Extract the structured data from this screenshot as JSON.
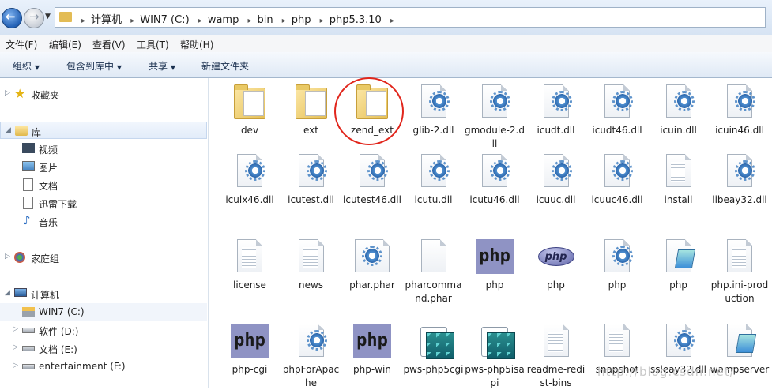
{
  "address_bar": {
    "crumbs": [
      "计算机",
      "WIN7 (C:)",
      "wamp",
      "bin",
      "php",
      "php5.3.10"
    ]
  },
  "menu": [
    "文件(F)",
    "编辑(E)",
    "查看(V)",
    "工具(T)",
    "帮助(H)"
  ],
  "toolbar": {
    "organize": "组织",
    "include_in_library": "包含到库中",
    "share": "共享",
    "new_folder": "新建文件夹"
  },
  "nav": {
    "favorites": "收藏夹",
    "libraries": "库",
    "lib_items": [
      "视频",
      "图片",
      "文档",
      "迅雷下载",
      "音乐"
    ],
    "homegroup": "家庭组",
    "computer": "计算机",
    "drives": [
      "WIN7 (C:)",
      "软件 (D:)",
      "文档 (E:)",
      "entertainment (F:)"
    ]
  },
  "files": [
    {
      "name": "dev",
      "icon": "folder-icon"
    },
    {
      "name": "ext",
      "icon": "folder-icon"
    },
    {
      "name": "zend_ext",
      "icon": "folder-icon"
    },
    {
      "name": "glib-2.dll",
      "icon": "dll-icon"
    },
    {
      "name": "gmodule-2.dll",
      "icon": "dll-icon"
    },
    {
      "name": "icudt.dll",
      "icon": "dll-icon"
    },
    {
      "name": "icudt46.dll",
      "icon": "dll-icon"
    },
    {
      "name": "icuin.dll",
      "icon": "dll-icon"
    },
    {
      "name": "icuin46.dll",
      "icon": "dll-icon"
    },
    {
      "name": "iculx46.dll",
      "icon": "dll-icon"
    },
    {
      "name": "icutest.dll",
      "icon": "dll-icon"
    },
    {
      "name": "icutest46.dll",
      "icon": "dll-icon"
    },
    {
      "name": "icutu.dll",
      "icon": "dll-icon"
    },
    {
      "name": "icutu46.dll",
      "icon": "dll-icon"
    },
    {
      "name": "icuuc.dll",
      "icon": "dll-icon"
    },
    {
      "name": "icuuc46.dll",
      "icon": "dll-icon"
    },
    {
      "name": "install",
      "icon": "text-file-icon"
    },
    {
      "name": "libeay32.dll",
      "icon": "dll-icon"
    },
    {
      "name": "license",
      "icon": "text-file-icon"
    },
    {
      "name": "news",
      "icon": "text-file-icon"
    },
    {
      "name": "phar.phar",
      "icon": "gear-file-icon"
    },
    {
      "name": "pharcommand.phar",
      "icon": "blank-file-icon"
    },
    {
      "name": "php",
      "icon": "php-square-icon"
    },
    {
      "name": "php",
      "icon": "php-oval-icon"
    },
    {
      "name": "php",
      "icon": "dll-icon"
    },
    {
      "name": "php",
      "icon": "notepad-icon"
    },
    {
      "name": "php.ini-production",
      "icon": "text-file-icon"
    },
    {
      "name": "php-cgi",
      "icon": "php-square-icon"
    },
    {
      "name": "phpForApache",
      "icon": "dll-icon"
    },
    {
      "name": "php-win",
      "icon": "php-square-icon"
    },
    {
      "name": "pws-php5cgi",
      "icon": "registry-icon"
    },
    {
      "name": "pws-php5isapi",
      "icon": "registry-icon"
    },
    {
      "name": "readme-redist-bins",
      "icon": "text-file-icon"
    },
    {
      "name": "snapshot",
      "icon": "text-file-icon"
    },
    {
      "name": "ssleay32.dll",
      "icon": "dll-icon"
    },
    {
      "name": "wampserver",
      "icon": "notepad-icon"
    }
  ],
  "watermark": "http://blog.csdn.net/"
}
